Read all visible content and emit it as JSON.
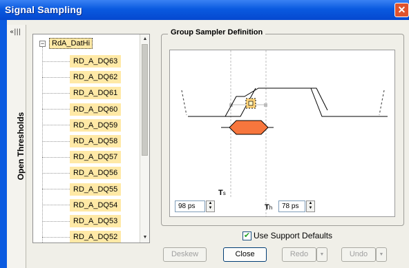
{
  "window": {
    "title": "Signal Sampling",
    "close_glyph": "✕"
  },
  "side_panel": {
    "label": "Open Thresholds",
    "collapse_glyph": "«|||"
  },
  "tree": {
    "root": "RdA_DatHi",
    "items": [
      "RD_A_DQ63",
      "RD_A_DQ62",
      "RD_A_DQ61",
      "RD_A_DQ60",
      "RD_A_DQ59",
      "RD_A_DQ58",
      "RD_A_DQ57",
      "RD_A_DQ56",
      "RD_A_DQ55",
      "RD_A_DQ54",
      "RD_A_DQ53",
      "RD_A_DQ52"
    ]
  },
  "group": {
    "title": "Group Sampler Definition",
    "ts_label": "T",
    "ts_sub": "s",
    "th_label": "T",
    "th_sub": "h",
    "ts_value": "98 ps",
    "th_value": "78 ps"
  },
  "use_support_defaults": {
    "label": "Use Support Defaults",
    "checked": true
  },
  "buttons": {
    "deskew": "Deskew",
    "close": "Close",
    "redo": "Redo",
    "undo": "Undo"
  },
  "colors": {
    "highlight": "#ffe9a6",
    "sampler_fill": "#f7763d",
    "title_bar": "#0a5ae0"
  }
}
